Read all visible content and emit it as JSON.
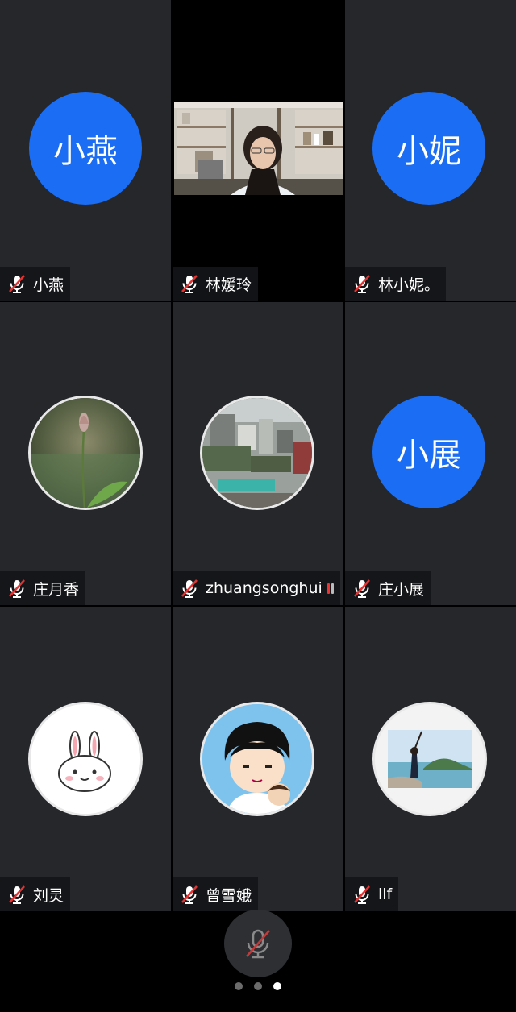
{
  "participants": [
    {
      "name": "小燕",
      "avatar_text": "小燕",
      "avatar_type": "letter",
      "muted": true
    },
    {
      "name": "林媛玲",
      "avatar_type": "video",
      "muted": true
    },
    {
      "name": "林小妮。",
      "avatar_text": "小妮",
      "avatar_type": "letter",
      "muted": true
    },
    {
      "name": "庄月香",
      "avatar_type": "photo-lotus",
      "muted": true
    },
    {
      "name": "zhuangsonghui",
      "avatar_type": "photo-aerial",
      "muted": true
    },
    {
      "name": "庄小展",
      "avatar_text": "小展",
      "avatar_type": "letter",
      "muted": true
    },
    {
      "name": "刘灵",
      "avatar_type": "photo-bunny",
      "muted": true
    },
    {
      "name": "曾雪娥",
      "avatar_type": "photo-cartoon",
      "muted": true
    },
    {
      "name": "llf",
      "avatar_type": "photo-seaside",
      "muted": true
    }
  ],
  "colors": {
    "accent": "#1b6ef3",
    "tile_bg": "#25272b",
    "muted_red": "#e33333"
  },
  "controls": {
    "mic_icon": "mic-off-icon"
  },
  "pager": {
    "pages": 3,
    "current": 3
  }
}
